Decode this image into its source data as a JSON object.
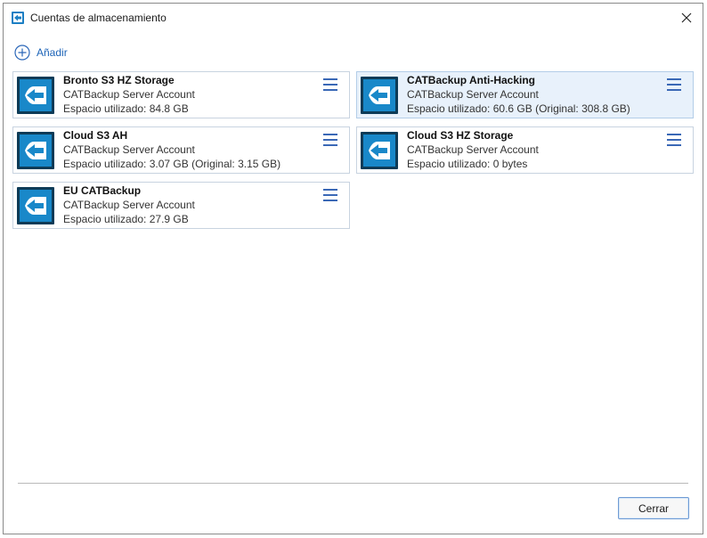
{
  "window": {
    "title": "Cuentas de almacenamiento",
    "close_icon": "close-icon"
  },
  "toolbar": {
    "add_label": "Añadir",
    "add_icon": "plus-circle-icon"
  },
  "accounts": [
    {
      "name": "Bronto S3 HZ Storage",
      "type": "CATBackup Server Account",
      "space": "Espacio utilizado: 84.8 GB",
      "selected": false
    },
    {
      "name": "CATBackup Anti-Hacking",
      "type": "CATBackup Server Account",
      "space": "Espacio utilizado: 60.6 GB (Original: 308.8 GB)",
      "selected": true
    },
    {
      "name": "Cloud S3 AH",
      "type": "CATBackup Server Account",
      "space": "Espacio utilizado: 3.07 GB (Original: 3.15 GB)",
      "selected": false
    },
    {
      "name": "Cloud S3 HZ Storage",
      "type": "CATBackup Server Account",
      "space": "Espacio utilizado: 0 bytes",
      "selected": false
    },
    {
      "name": "EU CATBackup",
      "type": "CATBackup Server Account",
      "space": "Espacio utilizado: 27.9 GB",
      "selected": false
    }
  ],
  "footer": {
    "close_label": "Cerrar"
  },
  "colors": {
    "accent": "#1c63b7",
    "icon_blue": "#1988c9",
    "selected_bg": "#e8f1fb"
  }
}
